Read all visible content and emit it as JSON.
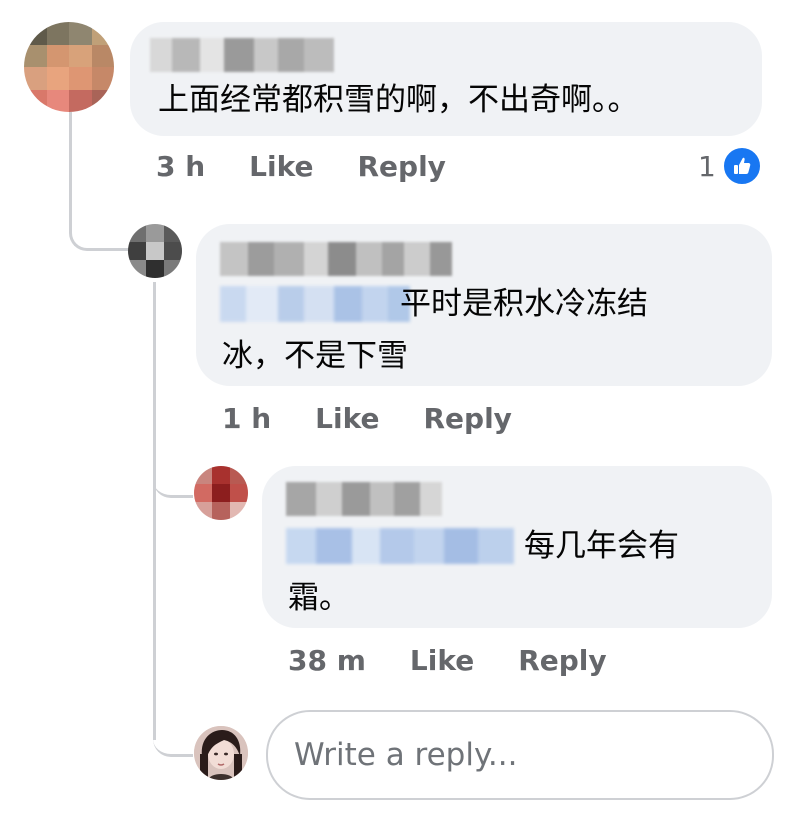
{
  "comments": [
    {
      "text": "上面经常都积雪的啊，不出奇啊。。",
      "time": "3 h",
      "like_label": "Like",
      "reply_label": "Reply",
      "like_count": "1"
    },
    {
      "text_line1": "平时是积水冷冻结",
      "text_line2": "冰，不是下雪",
      "time": "1 h",
      "like_label": "Like",
      "reply_label": "Reply"
    },
    {
      "text_line1": "每几年会有",
      "text_line2": "霜。",
      "time": "38 m",
      "like_label": "Like",
      "reply_label": "Reply"
    }
  ],
  "reply_box": {
    "placeholder": "Write a reply..."
  },
  "colors": {
    "bubble": "#f0f2f5",
    "meta_text": "#65676b",
    "like_blue": "#1877f2",
    "thread_line": "#ced0d4"
  }
}
